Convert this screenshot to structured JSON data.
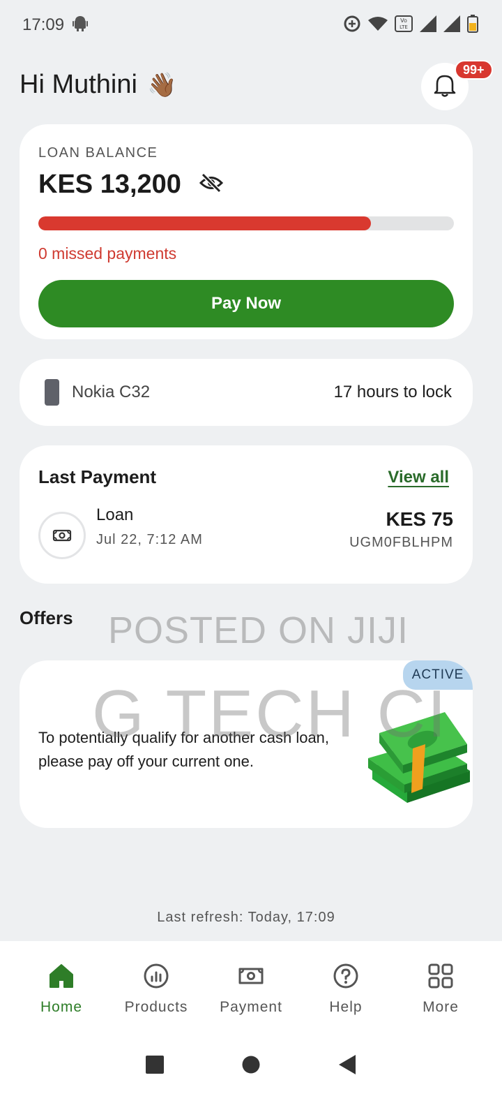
{
  "status_bar": {
    "time": "17:09",
    "icons": [
      "android-icon",
      "data-saver-icon",
      "wifi-icon",
      "volte-icon",
      "signal-icon",
      "signal-icon",
      "battery-icon"
    ]
  },
  "header": {
    "greeting": "Hi Muthini",
    "wave_emoji": "👋🏾",
    "notification_count": "99+"
  },
  "loan": {
    "label": "LOAN BALANCE",
    "amount": "KES 13,200",
    "progress_fraction": 0.8,
    "missed_text": "0 missed payments",
    "pay_button": "Pay Now",
    "accent_color": "#2e8b24",
    "progress_color": "#d9392f"
  },
  "device": {
    "name": "Nokia C32",
    "lock_text": "17 hours to lock"
  },
  "last_payment": {
    "title": "Last Payment",
    "view_all": "View all",
    "item": {
      "name": "Loan",
      "date": "Jul 22, 7:12 AM",
      "amount": "KES 75",
      "reference": "UGM0FBLHPM"
    }
  },
  "offers": {
    "title": "Offers",
    "badge": "ACTIVE",
    "text": "To potentially qualify for another cash loan, please pay off your current one."
  },
  "watermark": {
    "line1": "POSTED ON JIJI",
    "line2": "G TECH CI"
  },
  "refresh_text": "Last refresh: Today, 17:09",
  "bottom_nav": [
    {
      "label": "Home",
      "icon": "home-icon",
      "active": true
    },
    {
      "label": "Products",
      "icon": "products-chart-icon",
      "active": false
    },
    {
      "label": "Payment",
      "icon": "payment-icon",
      "active": false
    },
    {
      "label": "Help",
      "icon": "help-icon",
      "active": false
    },
    {
      "label": "More",
      "icon": "more-grid-icon",
      "active": false
    }
  ]
}
